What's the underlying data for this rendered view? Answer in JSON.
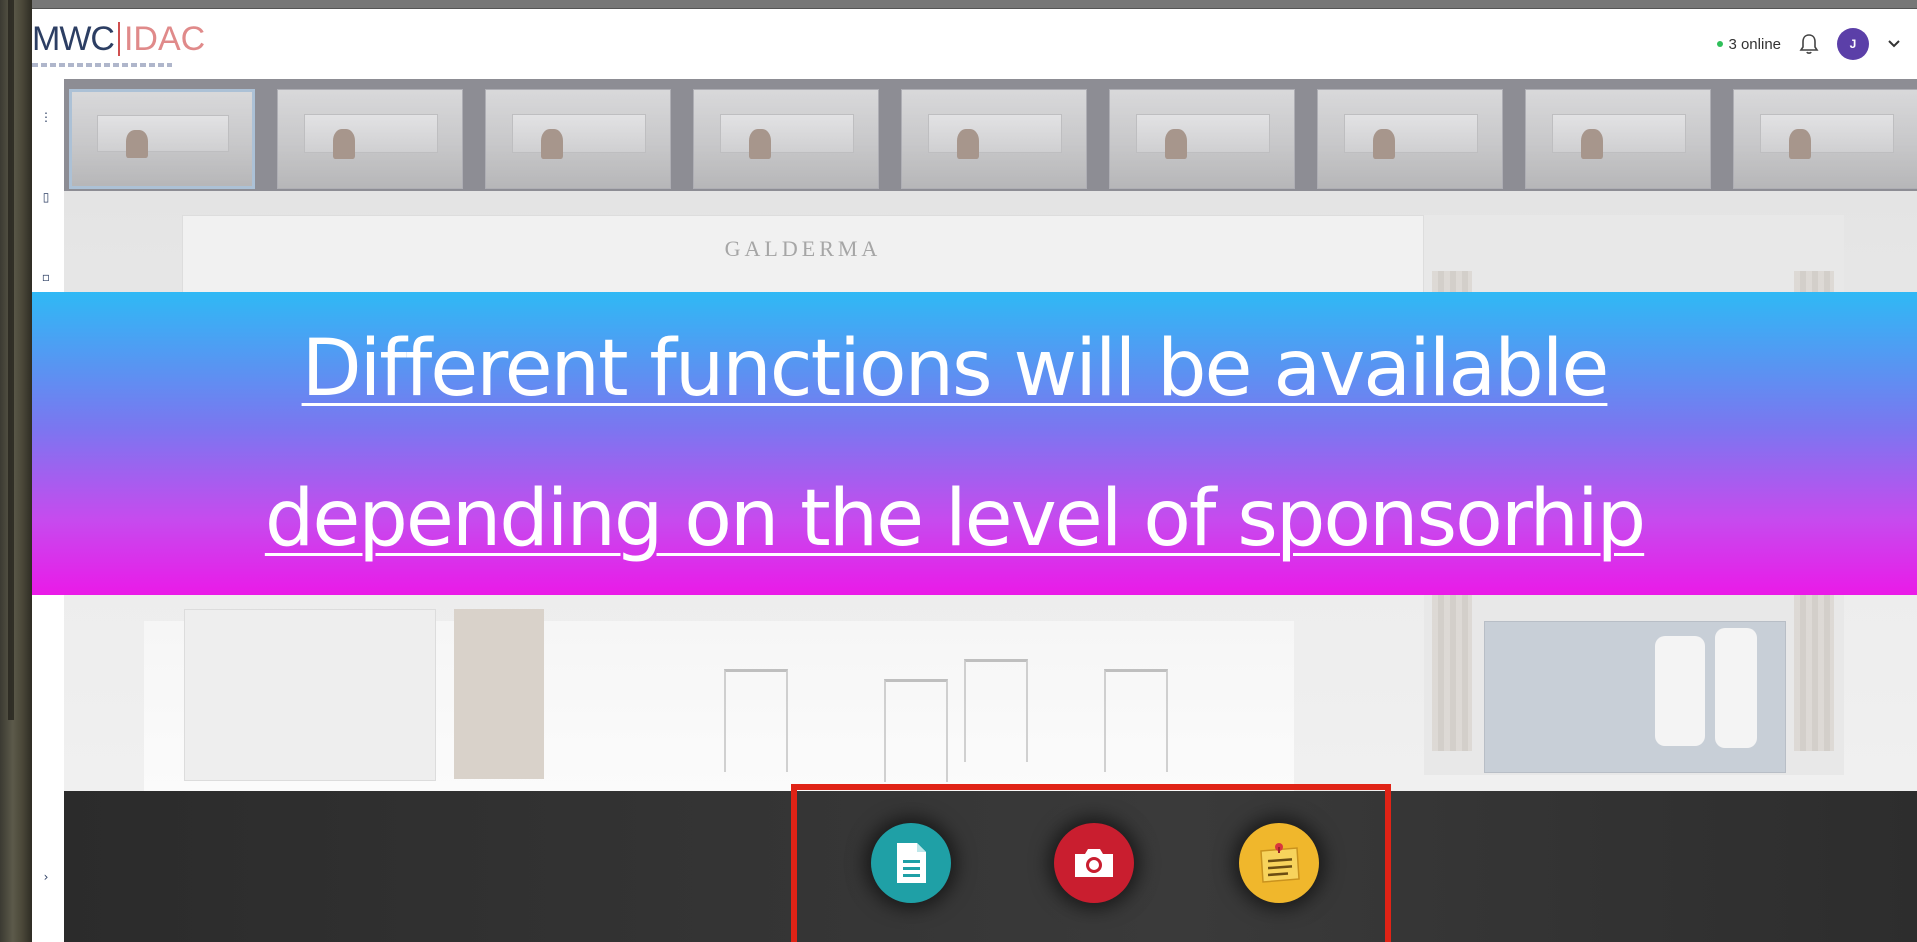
{
  "header": {
    "logo_primary": "MWC",
    "logo_secondary": "IDAC",
    "online_count": "3 online",
    "avatar_initial": "J",
    "icons": {
      "notifications": "bell-icon",
      "menu": "chevron-down-icon"
    }
  },
  "booth": {
    "brand": "GALDERMA",
    "thumbnail_count": 9,
    "selected_thumbnail": 0
  },
  "banner": {
    "line1": "Different functions will be available",
    "line2": "depending on the level of sponsorhip"
  },
  "toolbar": {
    "buttons": [
      {
        "name": "document",
        "icon": "document-icon",
        "color": "#1fa0a6"
      },
      {
        "name": "camera",
        "icon": "camera-icon",
        "color": "#c91e2f"
      },
      {
        "name": "note",
        "icon": "sticky-note-icon",
        "color": "#f0b72c"
      }
    ],
    "highlight_color": "#e02316"
  },
  "colors": {
    "banner_top": "#2fb9f5",
    "banner_bottom": "#ea1ae8",
    "avatar": "#5b3fa8",
    "online_dot": "#2fbf5a"
  }
}
